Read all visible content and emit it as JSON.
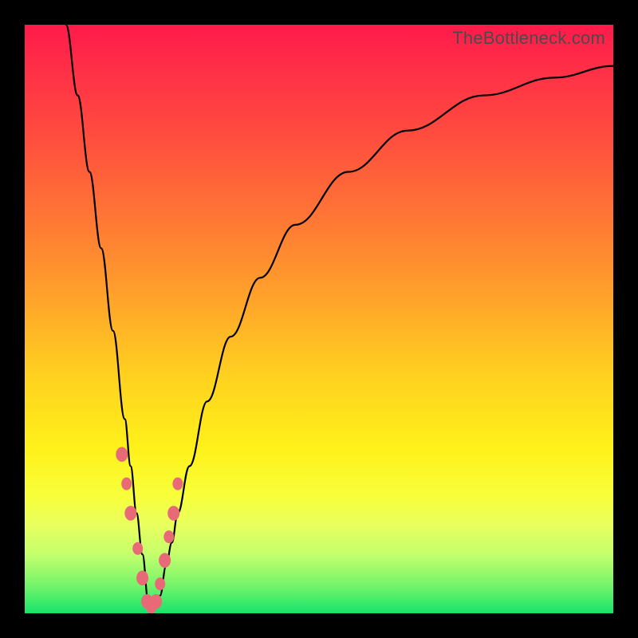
{
  "watermark": "TheBottleneck.com",
  "colors": {
    "gradient_top": "#ff1a4a",
    "gradient_mid": "#fff11a",
    "gradient_bottom": "#17e36b",
    "curve": "#000000",
    "marker": "#e96a77",
    "frame": "#000000"
  },
  "chart_data": {
    "type": "line",
    "title": "",
    "xlabel": "",
    "ylabel": "",
    "xlim": [
      0,
      100
    ],
    "ylim": [
      0,
      100
    ],
    "grid": false,
    "legend": false,
    "notes": "V-shaped bottleneck curve. x ≈ relative hardware capability (normalized 0–100, minimum near x≈21). y ≈ bottleneck percentage (0 at bottom, ~100 at top). Left branch drops steeply from top-left to the valley; right branch rises asymptotically toward the upper right.",
    "series": [
      {
        "name": "bottleneck-curve",
        "x": [
          7,
          9,
          11,
          13,
          15,
          17,
          18,
          19,
          20,
          21,
          22,
          23,
          24,
          25,
          26,
          28,
          31,
          35,
          40,
          46,
          55,
          65,
          78,
          90,
          100
        ],
        "y": [
          100,
          88,
          75,
          62,
          48,
          33,
          25,
          17,
          10,
          2,
          1,
          3,
          8,
          12,
          17,
          25,
          36,
          47,
          57,
          66,
          75,
          82,
          88,
          91,
          93
        ]
      }
    ],
    "markers": {
      "name": "highlighted-points",
      "note": "Dense salmon-colored markers clustered around the valley of the V, on both branches",
      "x": [
        16.5,
        17.3,
        18.0,
        19.2,
        20.0,
        20.8,
        21.5,
        22.3,
        23.0,
        23.8,
        24.5,
        25.3,
        26.0
      ],
      "y": [
        27,
        22,
        17,
        11,
        6,
        2,
        1,
        2,
        5,
        9,
        13,
        17,
        22
      ],
      "r": [
        7,
        6,
        7,
        6,
        7,
        7,
        6,
        7,
        6,
        7,
        6,
        7,
        6
      ]
    }
  }
}
